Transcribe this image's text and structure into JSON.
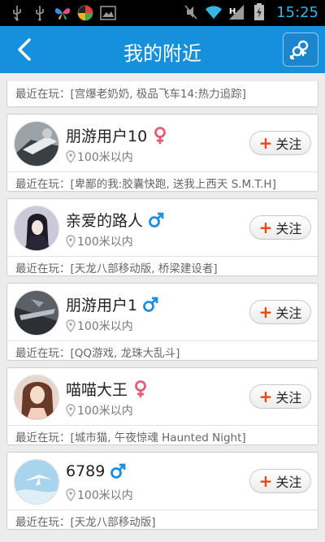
{
  "status_bar": {
    "time": "15:25",
    "icons": [
      "usb-icon",
      "usb-icon",
      "butterfly-app-icon",
      "colorful-app-icon",
      "image-icon",
      "mute-icon",
      "wifi-icon",
      "signal-icon",
      "battery-icon"
    ]
  },
  "nav": {
    "title": "我的附近",
    "back_icon": "back-chevron-icon",
    "filter_icon": "gender-filter-icon"
  },
  "colors": {
    "nav_bg": "#1490dc",
    "female": "#e85a78",
    "male": "#1e8fe0",
    "follow_plus": "#e8470f",
    "time": "#33b5e5"
  },
  "partial_item": {
    "recent": "最近在玩：[宫爆老奶奶, 极品飞车14:热力追踪]"
  },
  "users": [
    {
      "name": "朋游用户10",
      "gender": "female",
      "distance": "100米以内",
      "follow_label": "关注",
      "recent": "最近在玩：[卑鄙的我:胶囊快跑, 送我上西天 S.M.T.H]"
    },
    {
      "name": "亲爱的路人",
      "gender": "male",
      "distance": "100米以内",
      "follow_label": "关注",
      "recent": "最近在玩：[天龙八部移动版, 桥梁建设者]"
    },
    {
      "name": "朋游用户1",
      "gender": "male",
      "distance": "100米以内",
      "follow_label": "关注",
      "recent": "最近在玩：[QQ游戏, 龙珠大乱斗]"
    },
    {
      "name": "喵喵大王",
      "gender": "female",
      "distance": "100米以内",
      "follow_label": "关注",
      "recent": "最近在玩：[城市猫, 午夜惊魂 Haunted Night]"
    },
    {
      "name": "6789",
      "gender": "male",
      "distance": "100米以内",
      "follow_label": "关注",
      "recent": "最近在玩：[天龙八部移动版]"
    }
  ]
}
